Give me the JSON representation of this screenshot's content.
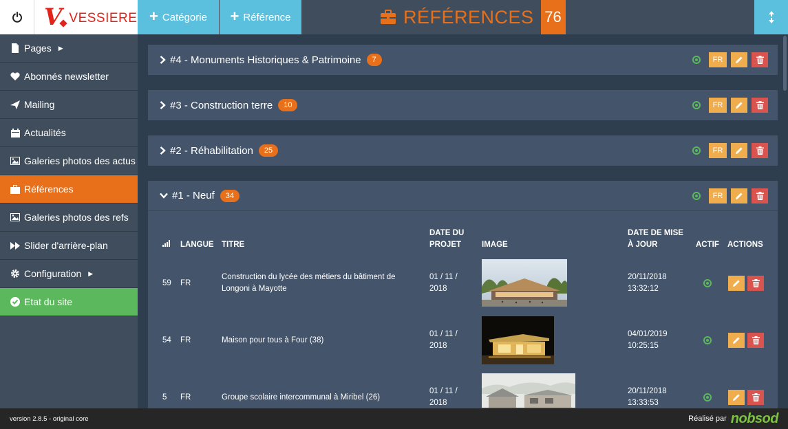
{
  "header": {
    "logo_text": "VESSIERE",
    "logo_mark": "V",
    "add_category_label": "Catégorie",
    "add_reference_label": "Référence",
    "page_title": "RÉFÉRENCES",
    "page_count": "76"
  },
  "sidebar": {
    "items": [
      {
        "label": "Pages",
        "icon": "file-icon"
      },
      {
        "label": "Abonnés newsletter",
        "icon": "heart-icon"
      },
      {
        "label": "Mailing",
        "icon": "send-icon"
      },
      {
        "label": "Actualités",
        "icon": "calendar-icon"
      },
      {
        "label": "Galeries photos des actus",
        "icon": "image-icon"
      },
      {
        "label": "Références",
        "icon": "briefcase-icon"
      },
      {
        "label": "Galeries photos des refs",
        "icon": "image-icon"
      },
      {
        "label": "Slider d'arrière-plan",
        "icon": "fast-forward-icon"
      },
      {
        "label": "Configuration",
        "icon": "cog-icon"
      },
      {
        "label": "Etat du site",
        "icon": "check-circle-icon"
      }
    ]
  },
  "categories": [
    {
      "title": "#4 - Monuments Historiques & Patrimoine",
      "count": "7",
      "lang": "FR"
    },
    {
      "title": "#3 - Construction terre",
      "count": "10",
      "lang": "FR"
    },
    {
      "title": "#2 - Réhabilitation",
      "count": "25",
      "lang": "FR"
    },
    {
      "title": "#1 - Neuf",
      "count": "34",
      "lang": "FR"
    }
  ],
  "table": {
    "headers": {
      "langue": "LANGUE",
      "titre": "TITRE",
      "date_projet_1": "DATE DU",
      "date_projet_2": "PROJET",
      "image": "IMAGE",
      "date_maj_1": "DATE DE MISE",
      "date_maj_2": "À JOUR",
      "actif": "ACTIF",
      "actions": "ACTIONS"
    },
    "rows": [
      {
        "order": "59",
        "lang": "FR",
        "title_1": "Construction du lycée des métiers du bâtiment de",
        "title_2": "Longoni à Mayotte",
        "date_1": "01 / 11 /",
        "date_2": "2018",
        "updated_1": "20/11/2018",
        "updated_2": "13:32:12"
      },
      {
        "order": "54",
        "lang": "FR",
        "title_1": "Maison pour tous à Four (38)",
        "title_2": "",
        "date_1": "01 / 11 /",
        "date_2": "2018",
        "updated_1": "04/01/2019",
        "updated_2": "10:25:15"
      },
      {
        "order": "5",
        "lang": "FR",
        "title_1": "Groupe scolaire intercommunal à Miribel (26)",
        "title_2": "",
        "date_1": "01 / 11 /",
        "date_2": "2018",
        "updated_1": "20/11/2018",
        "updated_2": "13:33:53"
      }
    ]
  },
  "footer": {
    "version": "version 2.8.5 - original core",
    "credit_label": "Réalisé par",
    "credit_brand": "nobsod"
  },
  "colors": {
    "orange": "#e8701a",
    "cyan": "#5bc0de",
    "green": "#5cb85c",
    "red": "#d9534f",
    "amber": "#f0ad4e"
  }
}
